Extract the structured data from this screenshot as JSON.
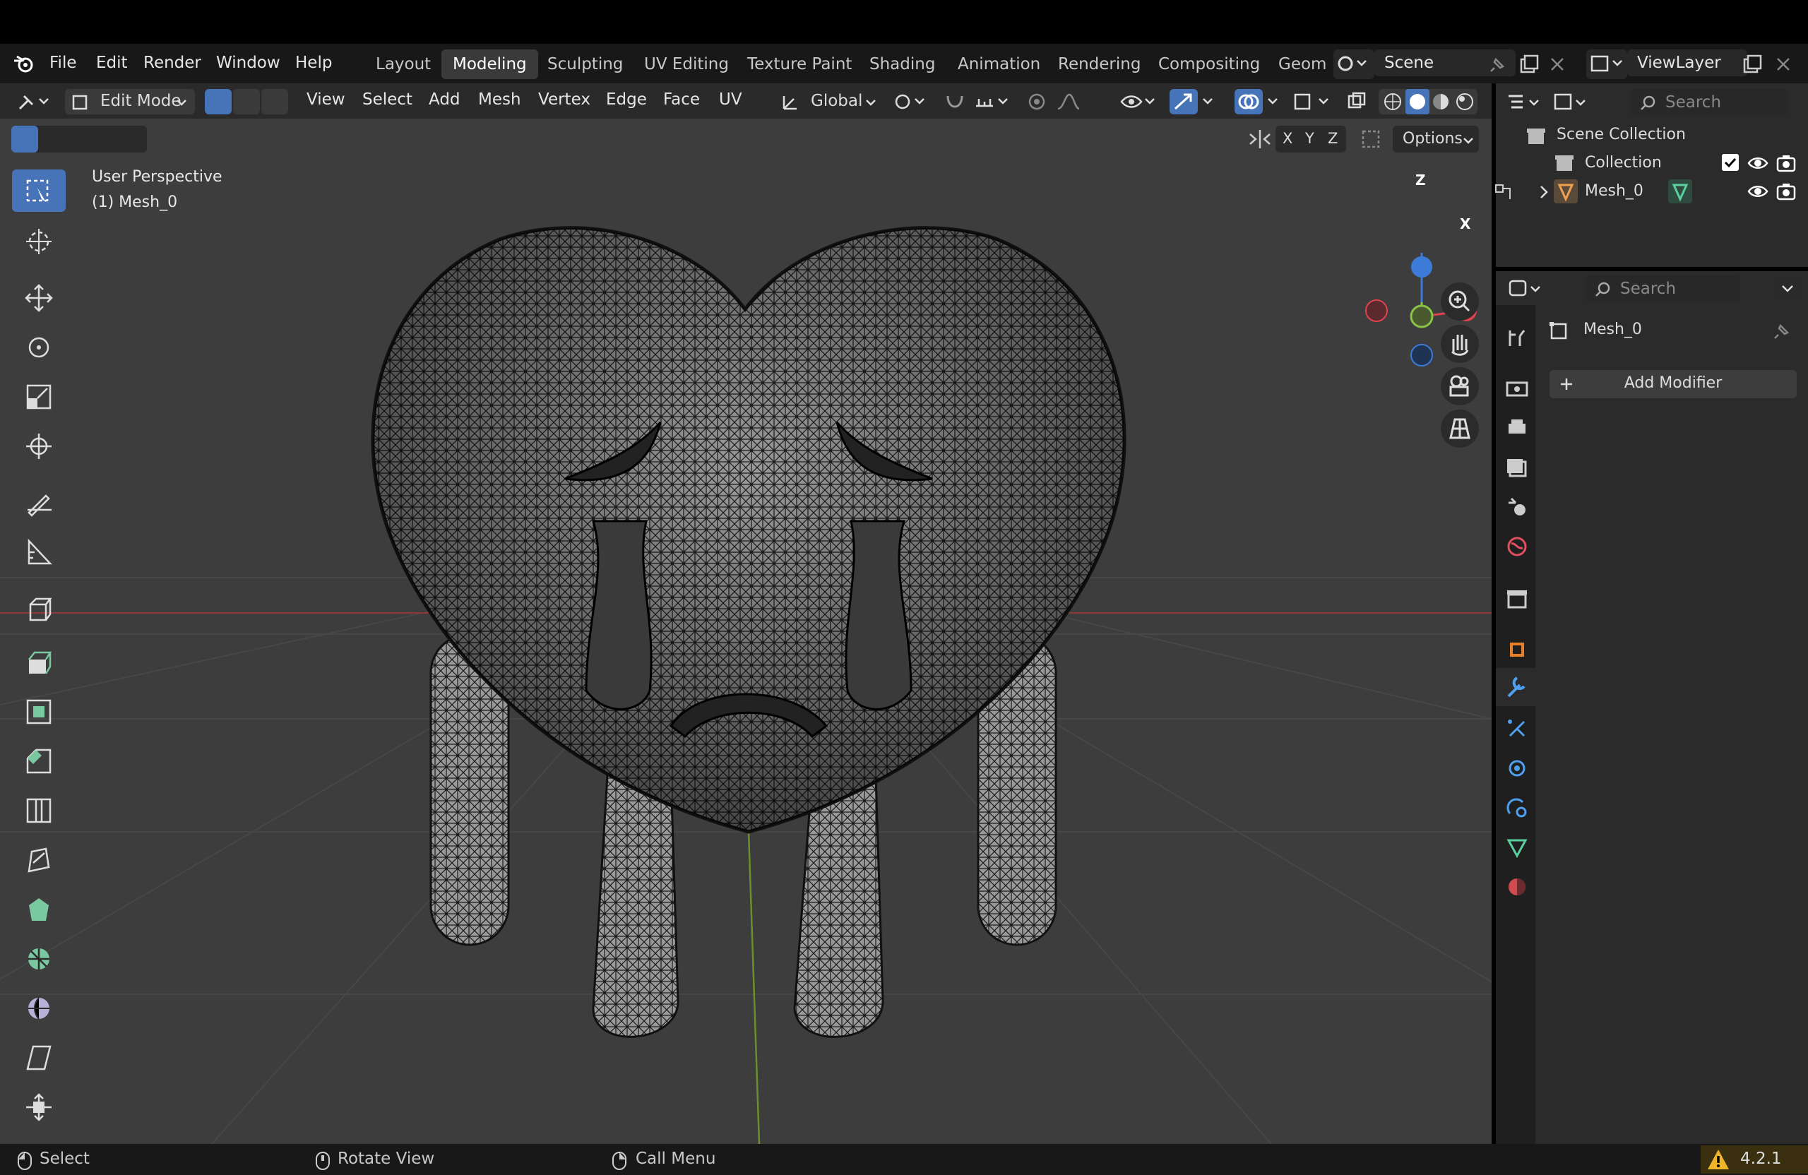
{
  "menubar": {
    "items": [
      "File",
      "Edit",
      "Render",
      "Window",
      "Help"
    ],
    "workspace_tabs": [
      "Layout",
      "Modeling",
      "Sculpting",
      "UV Editing",
      "Texture Paint",
      "Shading",
      "Animation",
      "Rendering",
      "Compositing",
      "Geom"
    ],
    "active_tab": "Modeling",
    "scene": "Scene",
    "view_layer": "ViewLayer"
  },
  "viewport_header": {
    "mode": "Edit Mode",
    "menus": [
      "View",
      "Select",
      "Add",
      "Mesh",
      "Vertex",
      "Edge",
      "Face",
      "UV"
    ],
    "orientation": "Global",
    "axes": [
      "X",
      "Y",
      "Z"
    ],
    "options": "Options"
  },
  "viewport": {
    "perspective": "User Perspective",
    "object": "(1) Mesh_0",
    "gizmo": {
      "z": "Z",
      "x": "X"
    }
  },
  "outliner": {
    "search_placeholder": "Search",
    "root": "Scene Collection",
    "collection": "Collection",
    "object": "Mesh_0"
  },
  "properties": {
    "search_placeholder": "Search",
    "object_name": "Mesh_0",
    "add_modifier": "Add Modifier"
  },
  "statusbar": {
    "select": "Select",
    "rotate": "Rotate View",
    "call_menu": "Call Menu",
    "version": "4.2.1"
  },
  "colors": {
    "accent": "#4773b8",
    "axis_x": "#e0434f",
    "axis_y": "#8bc34a",
    "axis_z": "#3d7bd9",
    "warning": "#f0b429"
  }
}
